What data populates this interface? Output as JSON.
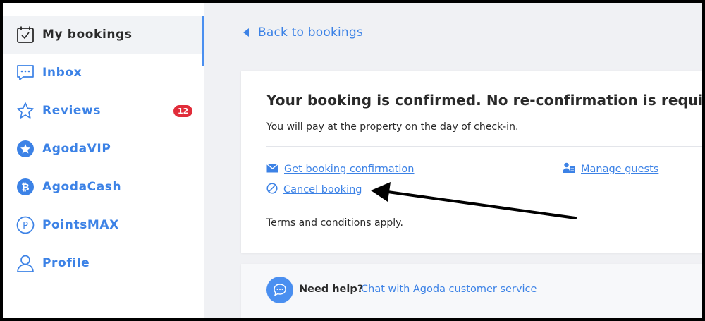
{
  "sidebar": {
    "items": [
      {
        "label": "My bookings",
        "icon": "calendar-check-icon"
      },
      {
        "label": "Inbox",
        "icon": "chat-icon"
      },
      {
        "label": "Reviews",
        "icon": "star-icon",
        "badge": "12"
      },
      {
        "label": "AgodaVIP",
        "icon": "vip-star-icon"
      },
      {
        "label": "AgodaCash",
        "icon": "cash-coin-icon"
      },
      {
        "label": "PointsMAX",
        "icon": "points-icon"
      },
      {
        "label": "Profile",
        "icon": "person-icon"
      }
    ]
  },
  "back_link": {
    "label": "Back to bookings"
  },
  "booking": {
    "title": "Your booking is confirmed. No re-confirmation is required.",
    "subtitle": "You will pay at the property on the day of check-in.",
    "get_confirmation": "Get booking confirmation",
    "manage_guests": "Manage guests",
    "cancel": "Cancel booking",
    "terms": "Terms and conditions apply."
  },
  "help": {
    "question": "Need help?",
    "link": "Chat with Agoda customer service"
  },
  "colors": {
    "accent": "#3c82e6",
    "badge": "#e12d3a",
    "text": "#2a2a2a",
    "annotation": "#000000"
  }
}
